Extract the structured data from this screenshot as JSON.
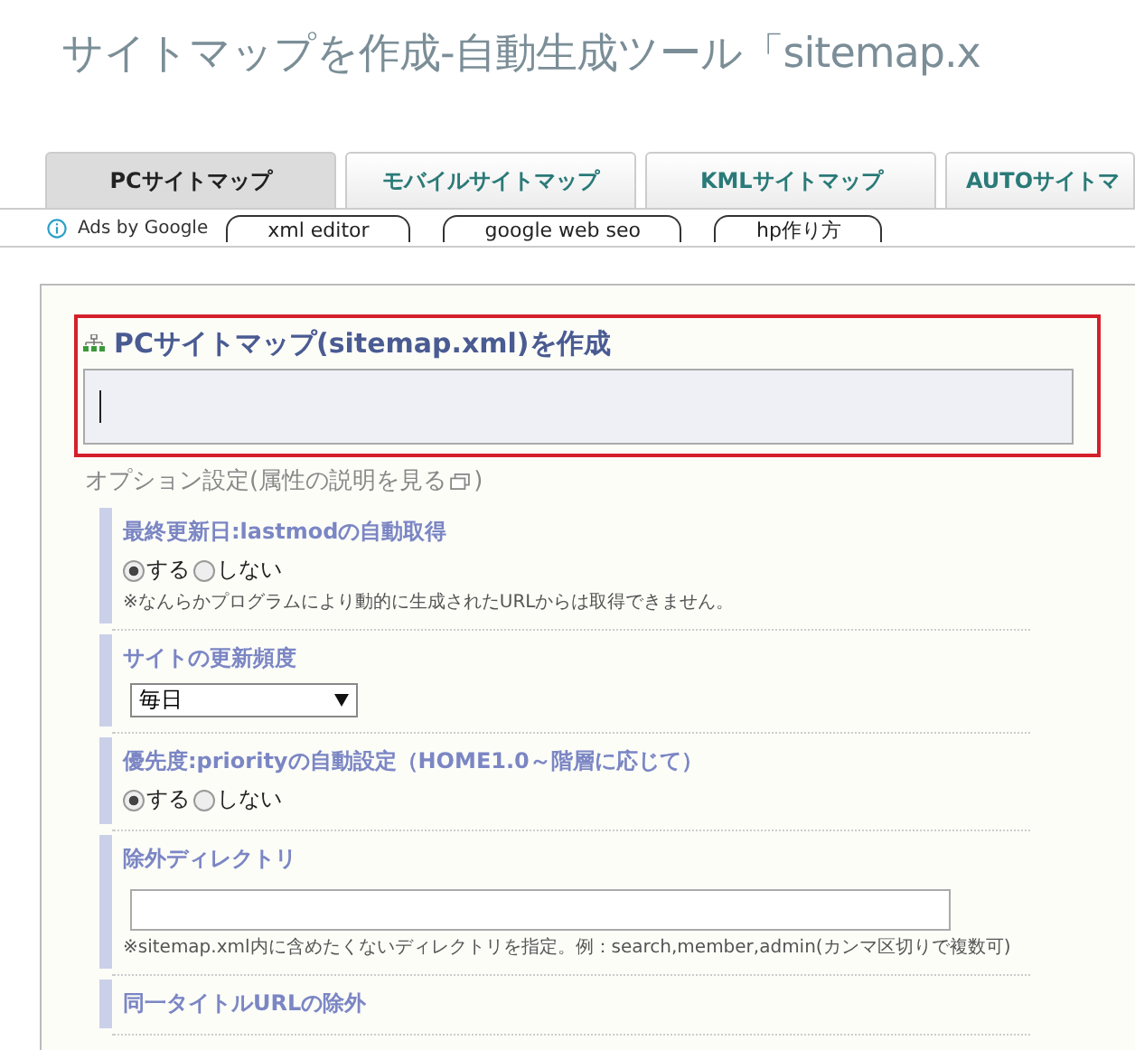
{
  "page_title": "サイトマップを作成-自動生成ツール「sitemap.x",
  "tabs": [
    {
      "label": "PCサイトマップ",
      "selected": true
    },
    {
      "label": "モバイルサイトマップ",
      "selected": false
    },
    {
      "label": "KMLサイトマップ",
      "selected": false
    },
    {
      "label": "AUTOサイトマ",
      "selected": false
    }
  ],
  "ads": {
    "label": "Ads by Google",
    "links": [
      "xml editor",
      "google web seo",
      "hp作り方"
    ]
  },
  "form": {
    "heading": "PCサイトマップ(sitemap.xml)を作成",
    "options_label": "オプション設定(属性の説明を見る",
    "options_close": ")",
    "sections": [
      {
        "kind": "radio",
        "title": "最終更新日:lastmodの自動取得",
        "options": [
          {
            "label": "する",
            "selected": true
          },
          {
            "label": "しない",
            "selected": false
          }
        ],
        "note": "※なんらかプログラムにより動的に生成されたURLからは取得できません。"
      },
      {
        "kind": "select",
        "title": "サイトの更新頻度",
        "value": "毎日"
      },
      {
        "kind": "radio",
        "title": "優先度:priorityの自動設定（HOME1.0～階層に応じて）",
        "options": [
          {
            "label": "する",
            "selected": true
          },
          {
            "label": "しない",
            "selected": false
          }
        ]
      },
      {
        "kind": "text",
        "title": "除外ディレクトリ",
        "note": "※sitemap.xml内に含めたくないディレクトリを指定。例：search,member,admin(カンマ区切りで複数可)"
      },
      {
        "kind": "title",
        "title": "同一タイトルURLの除外"
      }
    ]
  }
}
